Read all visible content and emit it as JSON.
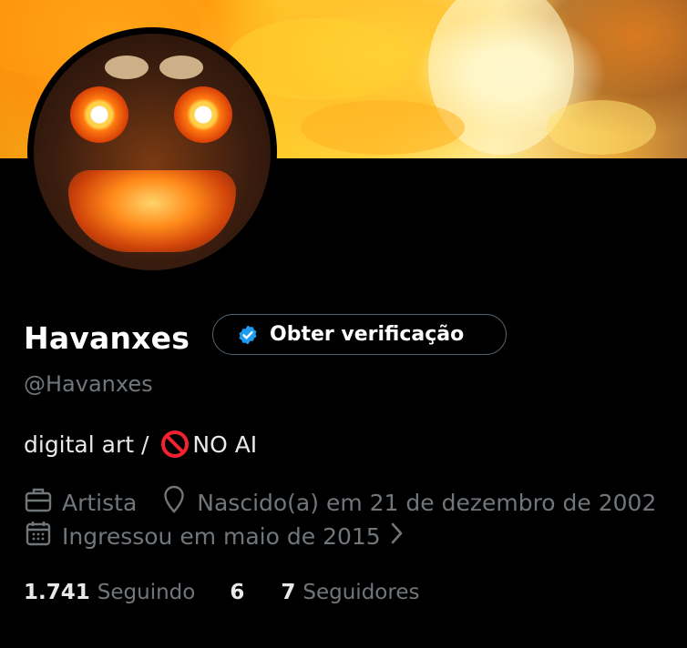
{
  "profile": {
    "display_name": "Havanxes",
    "handle": "@Havanxes",
    "bio_prefix": "digital art / ",
    "bio_suffix": "NO AI",
    "profession": "Artista",
    "birthday": "Nascido(a) em 21 de dezembro de 2002",
    "joined": "Ingressou em maio de 2015"
  },
  "verify_button": {
    "label": "Obter verificação"
  },
  "stats": {
    "following_count": "1.741",
    "following_label": "Seguindo",
    "unlabeled_count": "6",
    "followers_count": "7",
    "followers_label": "Seguidores"
  },
  "colors": {
    "background": "#000000",
    "text_primary": "#e7e9ea",
    "text_secondary": "#71767b",
    "verify_blue": "#1d9bf0",
    "no_ai_red": "#f4212e",
    "button_border": "#536471"
  },
  "icons": {
    "verified_badge": "verified-badge-icon",
    "no_entry": "no-entry-icon",
    "briefcase": "briefcase-icon",
    "location": "location-pin-icon",
    "calendar": "calendar-icon",
    "chevron": "chevron-right-icon"
  }
}
